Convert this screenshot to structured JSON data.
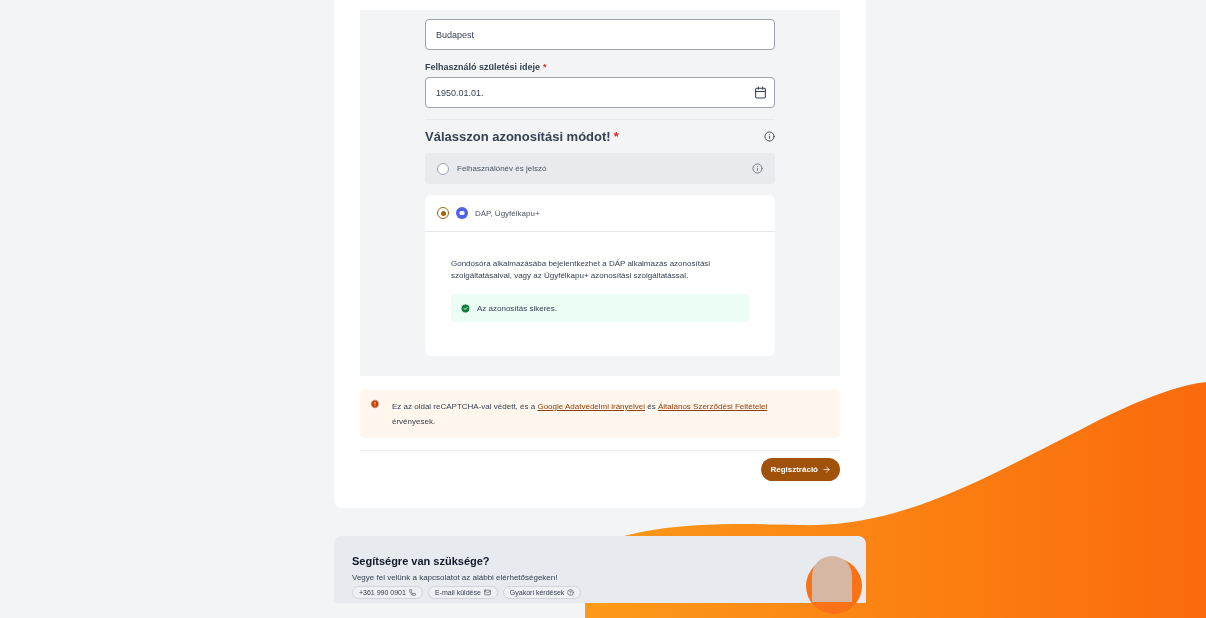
{
  "city_field": {
    "value": "Budapest"
  },
  "birth_date": {
    "label": "Felhasználó születési ideje",
    "required_mark": "*",
    "value": "1950.01.01."
  },
  "auth": {
    "heading": "Válasszon azonosítási módot!",
    "required_mark": "*",
    "options": [
      {
        "label": "Felhasználónév és jelszó",
        "selected": false,
        "kind": "plain"
      },
      {
        "label": "DÁP, Ügyfélkapu+",
        "selected": true,
        "kind": "dap",
        "description": "Gondosóra alkalmazásába bejelentkezhet a DÁP alkalmazás azonosítási szolgáltatásaival, vagy az Ügyfélkapu+ azonosítási szolgáltatással.",
        "status": "Az azonosítás sikeres."
      }
    ]
  },
  "notice": {
    "text_before": "Ez az oldal reCAPTCHA-val védett, és a",
    "link_1": "Google Adatvédelmi irányelvei",
    "text_middle": "és",
    "link_2": "Általános Szerződési Feltételei",
    "text_after": "érvényesek."
  },
  "submit_button": "Regisztráció",
  "help": {
    "title": "Segítségre van szüksége?",
    "subtitle": "Vegye fel velünk a kapcsolatot az alábbi elérhetőségeken!",
    "chips": [
      {
        "label": "+361 990 0901",
        "kind": "phone"
      },
      {
        "label": "E-mail küldése",
        "kind": "mail"
      },
      {
        "label": "Gyakori kérdések",
        "kind": "faq"
      }
    ]
  }
}
